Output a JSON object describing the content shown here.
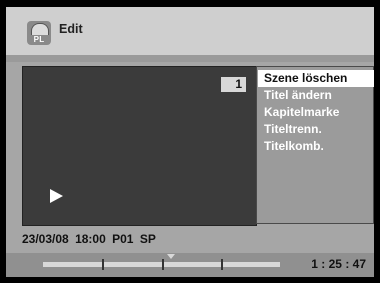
{
  "header": {
    "icon": "playlist-disc-icon",
    "icon_label": "PL",
    "title": "Edit"
  },
  "video": {
    "scene_number": "1",
    "state": "play-icon"
  },
  "menu": {
    "items": [
      {
        "label": "Szene löschen",
        "selected": true
      },
      {
        "label": "Titel ändern",
        "selected": false
      },
      {
        "label": "Kapitelmarke",
        "selected": false
      },
      {
        "label": "Titeltrenn.",
        "selected": false
      },
      {
        "label": "Titelkomb.",
        "selected": false
      }
    ]
  },
  "info": {
    "date": "23/03/08",
    "time": "18:00",
    "program": "P01",
    "mode": "SP"
  },
  "footer": {
    "elapsed": "1 : 25 : 47",
    "progress_fraction": 0.54,
    "chapter_fractions": [
      0.25,
      0.5,
      0.75
    ]
  },
  "colors": {
    "background": "#cfcfcf",
    "panel": "#a6a6a6",
    "video": "#3b3b3b",
    "highlight": "#ffffff"
  }
}
